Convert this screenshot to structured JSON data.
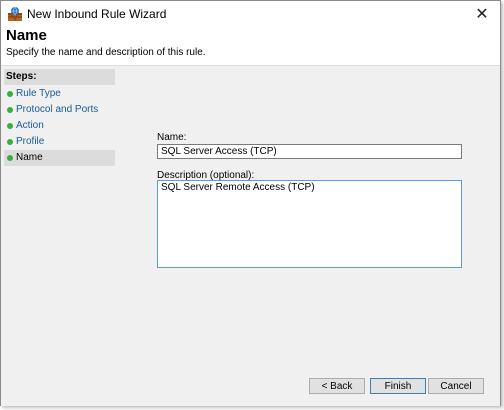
{
  "window": {
    "title": "New Inbound Rule Wizard",
    "close_glyph": "✕"
  },
  "header": {
    "heading": "Name",
    "description": "Specify the name and description of this rule."
  },
  "steps": {
    "title": "Steps:",
    "items": [
      {
        "label": "Rule Type",
        "current": false
      },
      {
        "label": "Protocol and Ports",
        "current": false
      },
      {
        "label": "Action",
        "current": false
      },
      {
        "label": "Profile",
        "current": false
      },
      {
        "label": "Name",
        "current": true
      }
    ],
    "dot_color": "#3cae3c"
  },
  "form": {
    "name_label": "Name:",
    "name_value": "SQL Server Access (TCP)",
    "description_label": "Description (optional):",
    "description_value": "SQL Server Remote Access (TCP)"
  },
  "buttons": {
    "back": "< Back",
    "finish": "Finish",
    "cancel": "Cancel"
  }
}
